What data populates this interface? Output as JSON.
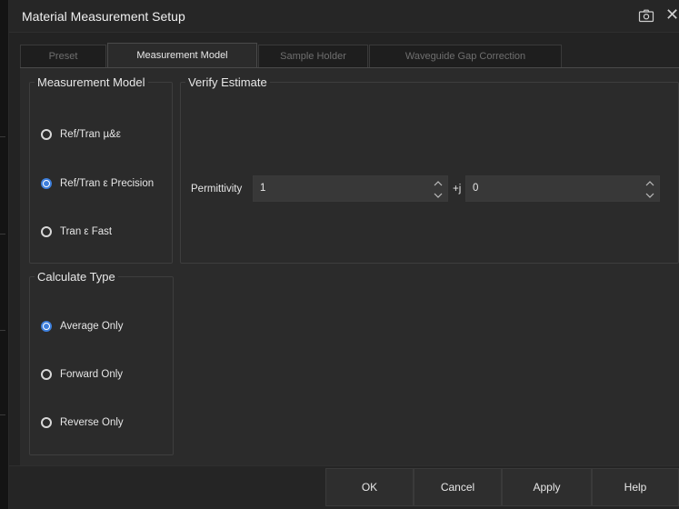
{
  "window": {
    "title": "Material Measurement Setup"
  },
  "tabs": [
    {
      "label": "Preset",
      "active": false
    },
    {
      "label": "Measurement Model",
      "active": true
    },
    {
      "label": "Sample Holder",
      "active": false
    },
    {
      "label": "Waveguide Gap Correction",
      "active": false
    }
  ],
  "measurement_model": {
    "legend": "Measurement Model",
    "options": [
      {
        "label": "Ref/Tran µ&ε",
        "selected": false
      },
      {
        "label": "Ref/Tran ε Precision",
        "selected": true
      },
      {
        "label": "Tran ε Fast",
        "selected": false
      }
    ]
  },
  "verify_estimate": {
    "legend": "Verify Estimate",
    "permittivity_label": "Permittivity",
    "real_value": "1",
    "imag_prefix": "+j",
    "imag_value": "0"
  },
  "calculate_type": {
    "legend": "Calculate Type",
    "options": [
      {
        "label": "Average Only",
        "selected": true
      },
      {
        "label": "Forward Only",
        "selected": false
      },
      {
        "label": "Reverse Only",
        "selected": false
      }
    ]
  },
  "buttons": {
    "ok": "OK",
    "cancel": "Cancel",
    "apply": "Apply",
    "help": "Help"
  },
  "icons": {
    "camera": "camera-icon",
    "close": "close-icon"
  },
  "colors": {
    "accent": "#3d7fdc",
    "background": "#2b2b2b"
  }
}
